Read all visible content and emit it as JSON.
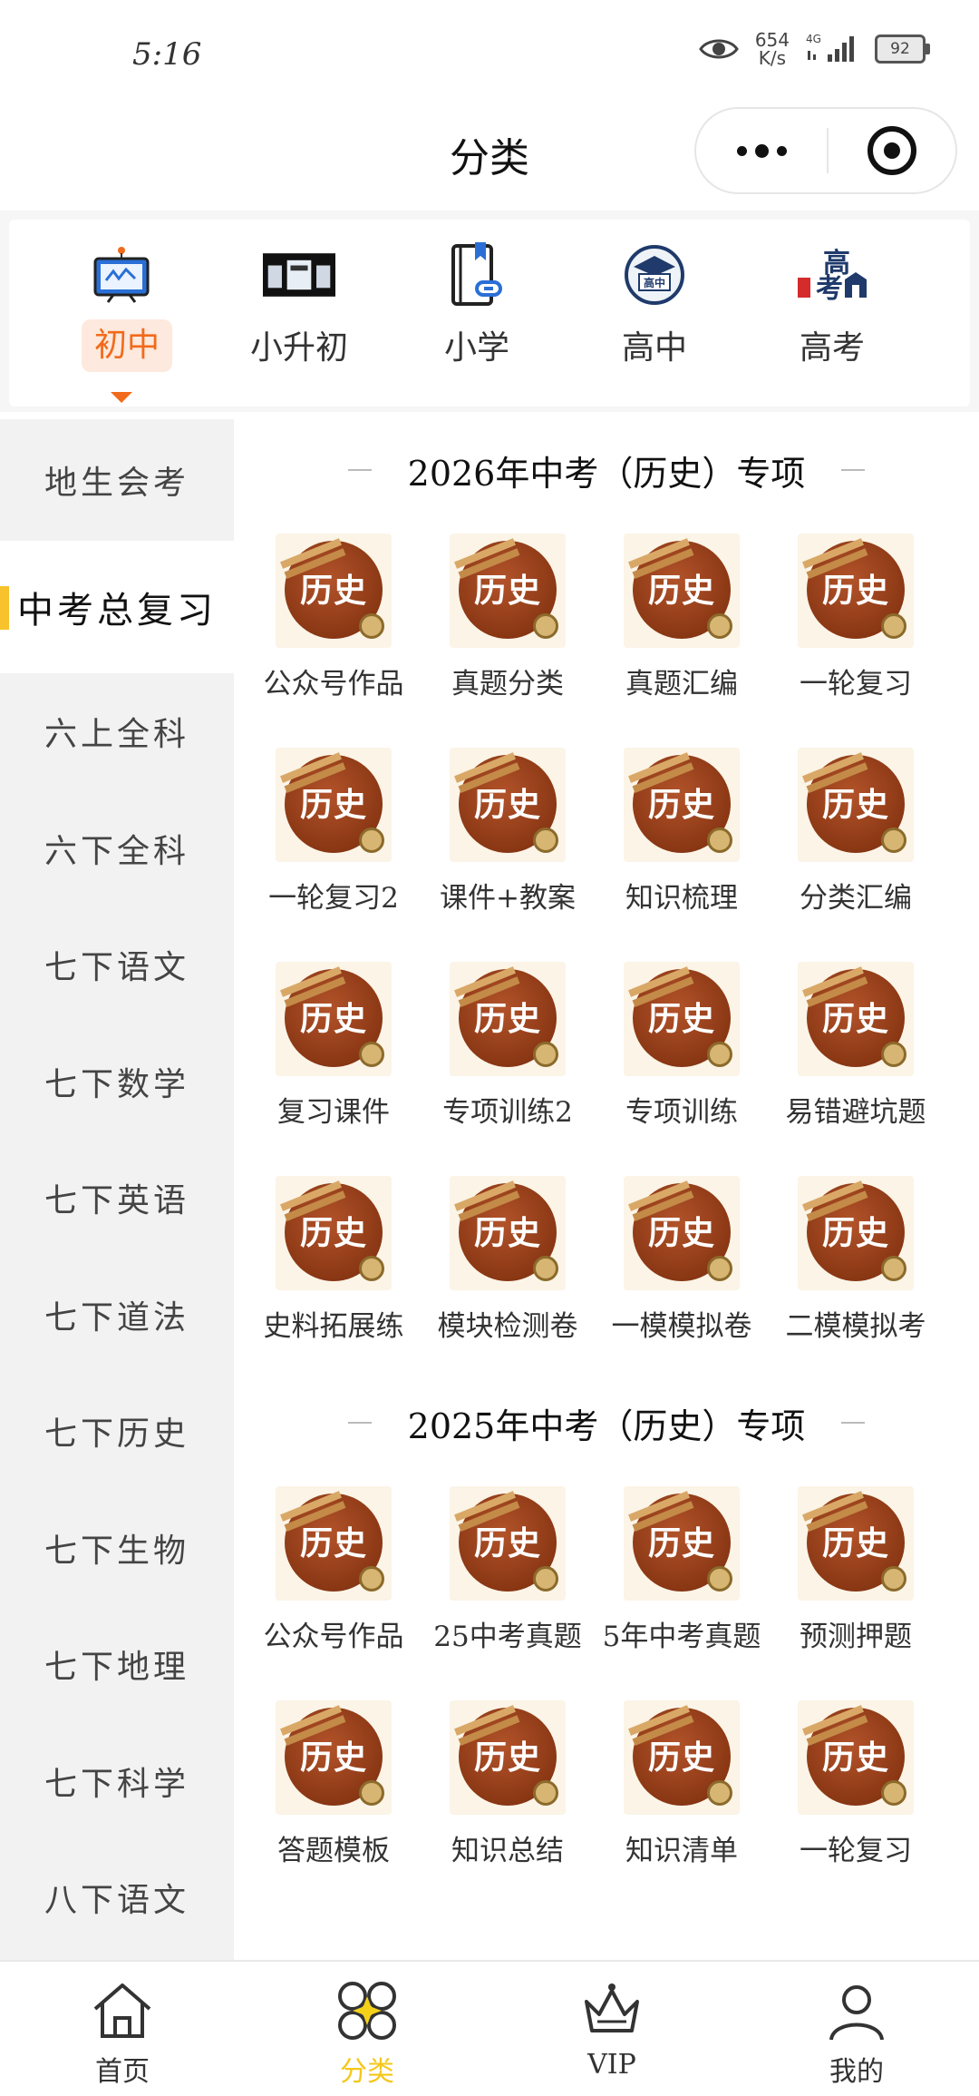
{
  "status_bar": {
    "time": "5:16",
    "speed_value": "654",
    "speed_unit": "K/s",
    "network": "4G",
    "battery": "92"
  },
  "nav": {
    "title": "分类"
  },
  "grades": [
    {
      "label": "初中",
      "icon": "monitor-icon",
      "active": true
    },
    {
      "label": "小升初",
      "icon": "banner-image"
    },
    {
      "label": "小学",
      "icon": "book-link-icon"
    },
    {
      "label": "高中",
      "icon": "high-school-badge-icon"
    },
    {
      "label": "高考",
      "icon": "gaokao-logo-icon"
    }
  ],
  "sidebar": {
    "items": [
      "地生会考",
      "中考总复习",
      "六上全科",
      "六下全科",
      "七下语文",
      "七下数学",
      "七下英语",
      "七下道法",
      "七下历史",
      "七下生物",
      "七下地理",
      "七下科学",
      "八下语文"
    ],
    "active_index": 1
  },
  "thumb_text": "历史",
  "sections": [
    {
      "title": "2026年中考（历史）专项",
      "items": [
        "公众号作品",
        "真题分类",
        "真题汇编",
        "一轮复习",
        "一轮复习2",
        "课件+教案",
        "知识梳理",
        "分类汇编",
        "复习课件",
        "专项训练2",
        "专项训练",
        "易错避坑题",
        "史料拓展练",
        "模块检测卷",
        "一模模拟卷",
        "二模模拟考"
      ]
    },
    {
      "title": "2025年中考（历史）专项",
      "items": [
        "公众号作品",
        "25中考真题",
        "5年中考真题",
        "预测押题",
        "答题模板",
        "知识总结",
        "知识清单",
        "一轮复习"
      ]
    }
  ],
  "tabbar": [
    {
      "label": "首页",
      "icon": "home-icon"
    },
    {
      "label": "分类",
      "icon": "category-icon",
      "active": true
    },
    {
      "label": "VIP",
      "icon": "crown-icon"
    },
    {
      "label": "我的",
      "icon": "user-icon"
    }
  ],
  "colors": {
    "accent_orange": "#f26a1b",
    "accent_yellow": "#f7c22c",
    "history_brown": "#8a3714"
  }
}
